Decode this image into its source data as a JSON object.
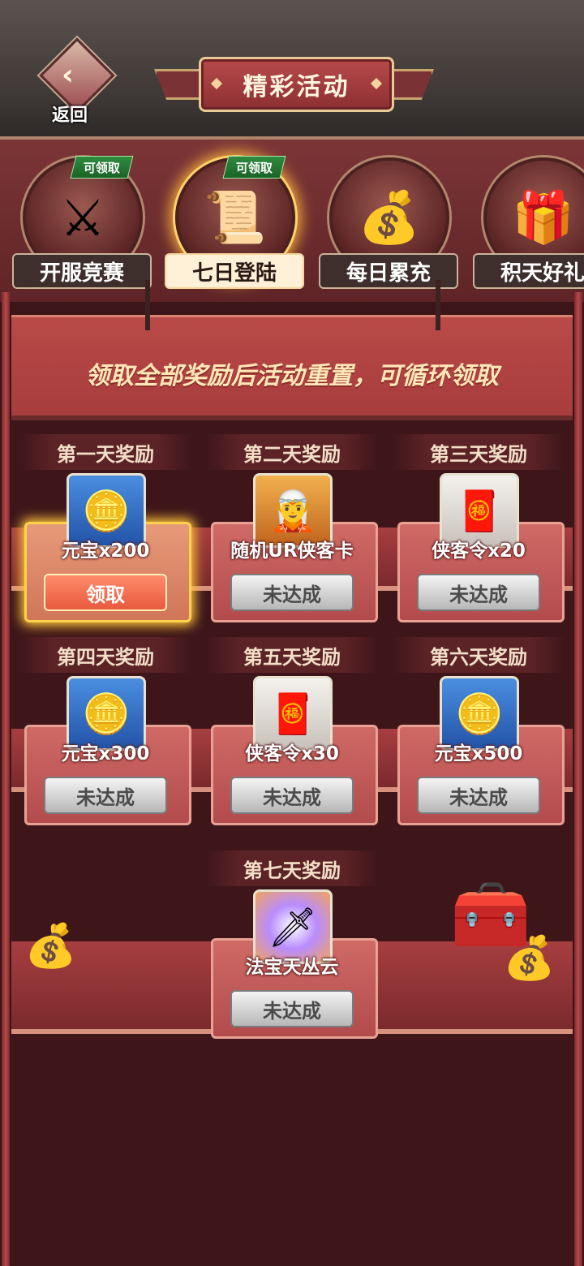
{
  "header": {
    "back_label": "返回",
    "title": "精彩活动"
  },
  "tabs": [
    {
      "label": "开服竞赛",
      "badge": "可领取",
      "icon": "crossed-swords-icon",
      "glyph": "⚔"
    },
    {
      "label": "七日登陆",
      "badge": "可领取",
      "icon": "scroll-icon",
      "glyph": "📜"
    },
    {
      "label": "每日累充",
      "badge": "",
      "icon": "gold-chest-icon",
      "glyph": "💰"
    },
    {
      "label": "积天好礼",
      "badge": "",
      "icon": "gift-chest-icon",
      "glyph": "🎁"
    }
  ],
  "notice": "领取全部奖励后活动重置，可循环领取",
  "days": [
    {
      "title": "第一天奖励",
      "item": "元宝x200",
      "button": "领取",
      "state": "ready",
      "icon": "gold-ingot-icon"
    },
    {
      "title": "第二天奖励",
      "item": "随机UR侠客卡",
      "button": "未达成",
      "state": "locked",
      "icon": "hero-card-icon"
    },
    {
      "title": "第三天奖励",
      "item": "侠客令x20",
      "button": "未达成",
      "state": "locked",
      "icon": "hero-token-icon"
    },
    {
      "title": "第四天奖励",
      "item": "元宝x300",
      "button": "未达成",
      "state": "locked",
      "icon": "gold-ingot-icon"
    },
    {
      "title": "第五天奖励",
      "item": "侠客令x30",
      "button": "未达成",
      "state": "locked",
      "icon": "hero-token-icon"
    },
    {
      "title": "第六天奖励",
      "item": "元宝x500",
      "button": "未达成",
      "state": "locked",
      "icon": "gold-ingot-icon"
    },
    {
      "title": "第七天奖励",
      "item": "法宝天丛云",
      "button": "未达成",
      "state": "locked",
      "icon": "sword-artifact-icon"
    }
  ]
}
